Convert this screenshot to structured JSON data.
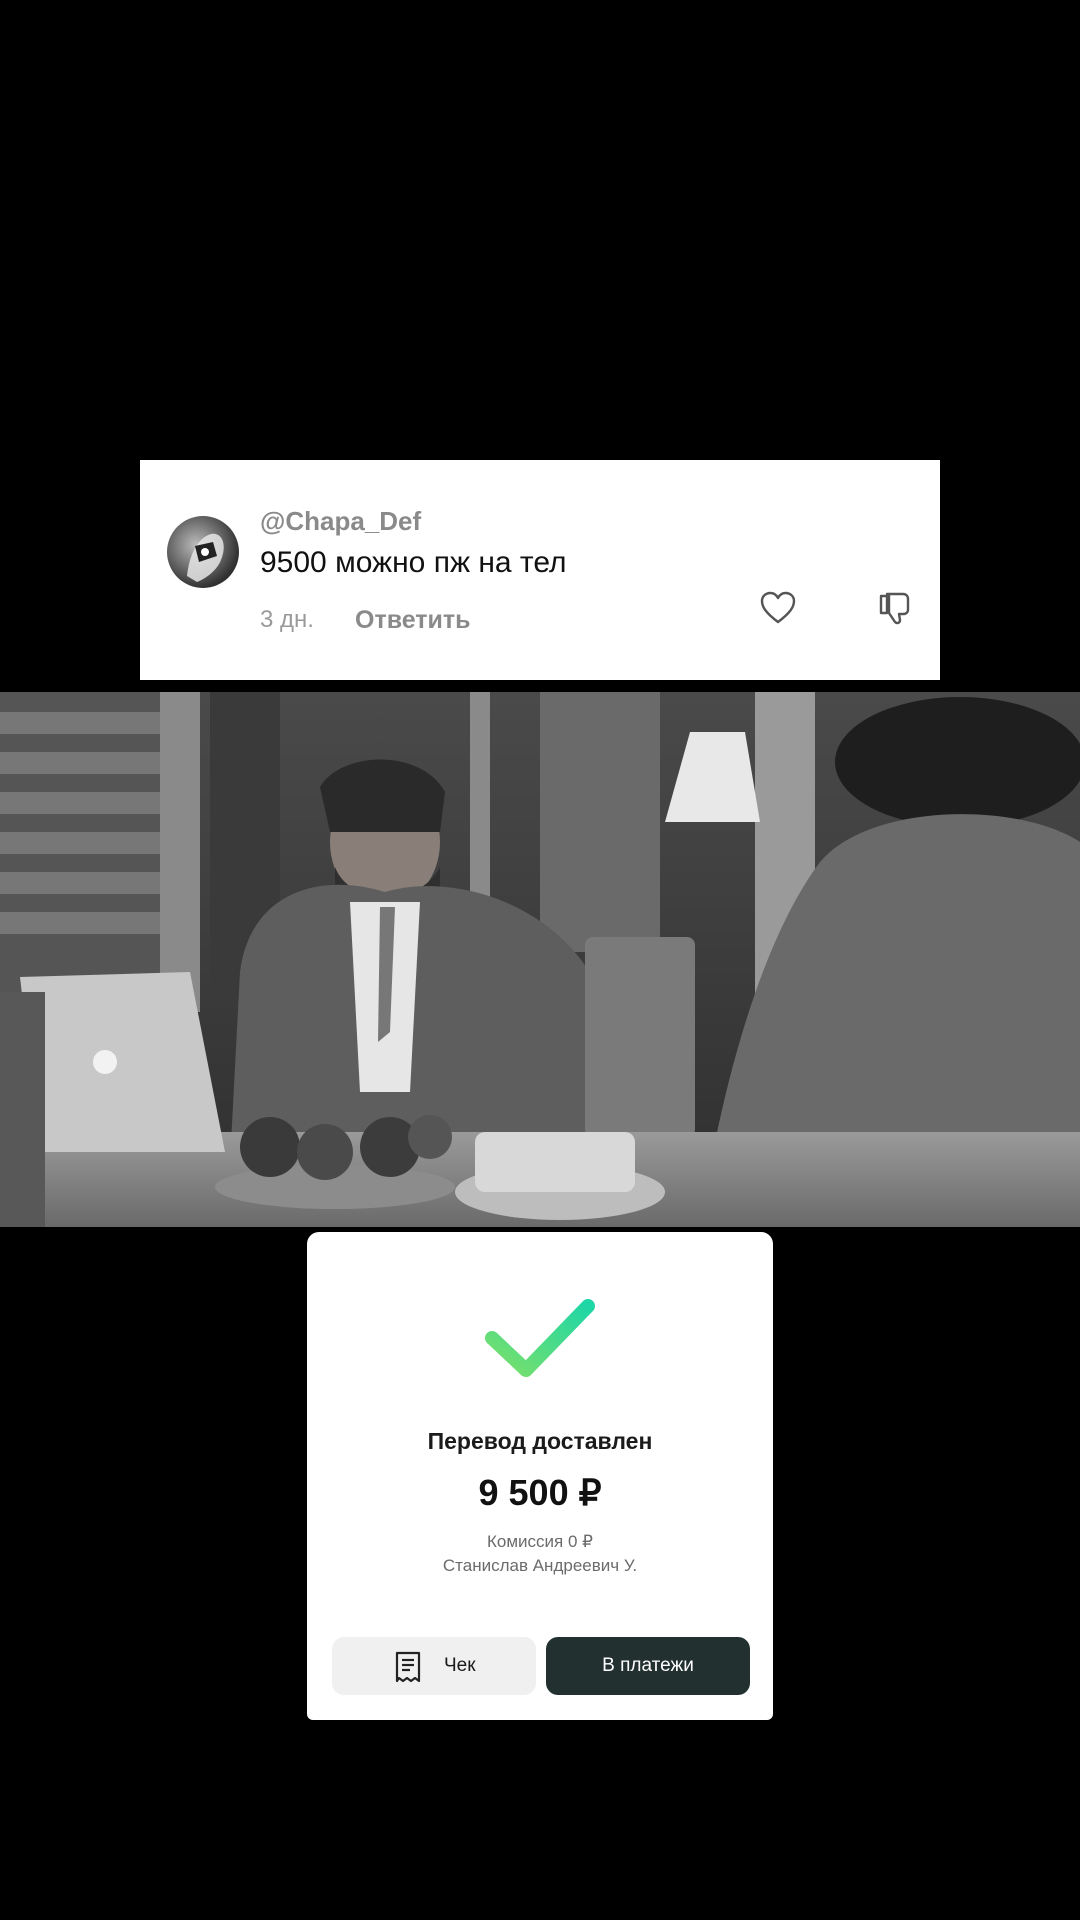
{
  "comment": {
    "username": "@Chapa_Def",
    "text": "9500 можно пж на тел",
    "time": "3 дн.",
    "reply_label": "Ответить"
  },
  "icons": {
    "like": "heart-icon",
    "dislike": "thumbs-down-icon",
    "receipt": "receipt-icon",
    "success": "checkmark-icon"
  },
  "payment": {
    "title": "Перевод доставлен",
    "amount": "9 500 ₽",
    "fee": "Комиссия 0 ₽",
    "recipient": "Станислав Андреевич У.",
    "receipt_label": "Чек",
    "payments_label": "В платежи"
  },
  "colors": {
    "check_gradient_start": "#7be06a",
    "check_gradient_end": "#1fd6a6",
    "primary_button": "#22302f"
  }
}
